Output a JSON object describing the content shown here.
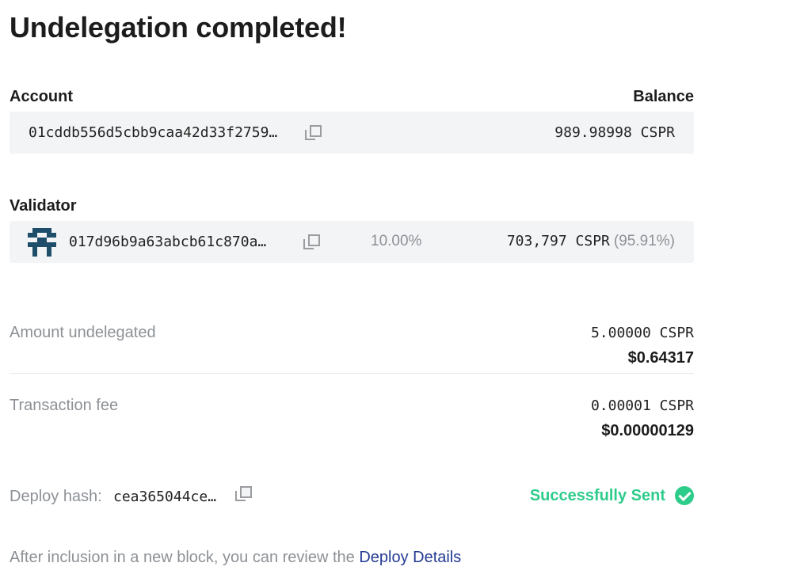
{
  "title": "Undelegation completed!",
  "account": {
    "label": "Account",
    "balance_label": "Balance",
    "hash": "01cddb556d5cbb9caa42d33f2759…",
    "balance": "989.98998 CSPR"
  },
  "validator": {
    "label": "Validator",
    "hash": "017d96b9a63abcb61c870a…",
    "fee": "10.00%",
    "stake": "703,797 CSPR",
    "stake_pct": "(95.91%)"
  },
  "amount": {
    "label": "Amount undelegated",
    "cspr": "5.00000 CSPR",
    "usd": "$0.64317"
  },
  "fee": {
    "label": "Transaction fee",
    "cspr": "0.00001 CSPR",
    "usd": "$0.00000129"
  },
  "deploy": {
    "label": "Deploy hash:",
    "hash": "cea365044ce…",
    "status": "Successfully Sent"
  },
  "footer": {
    "text": "After inclusion in a new block, you can review the ",
    "link": "Deploy Details"
  },
  "colors": {
    "success": "#2ecc8b",
    "link": "#243b93",
    "avatar": "#1f4e6b"
  }
}
